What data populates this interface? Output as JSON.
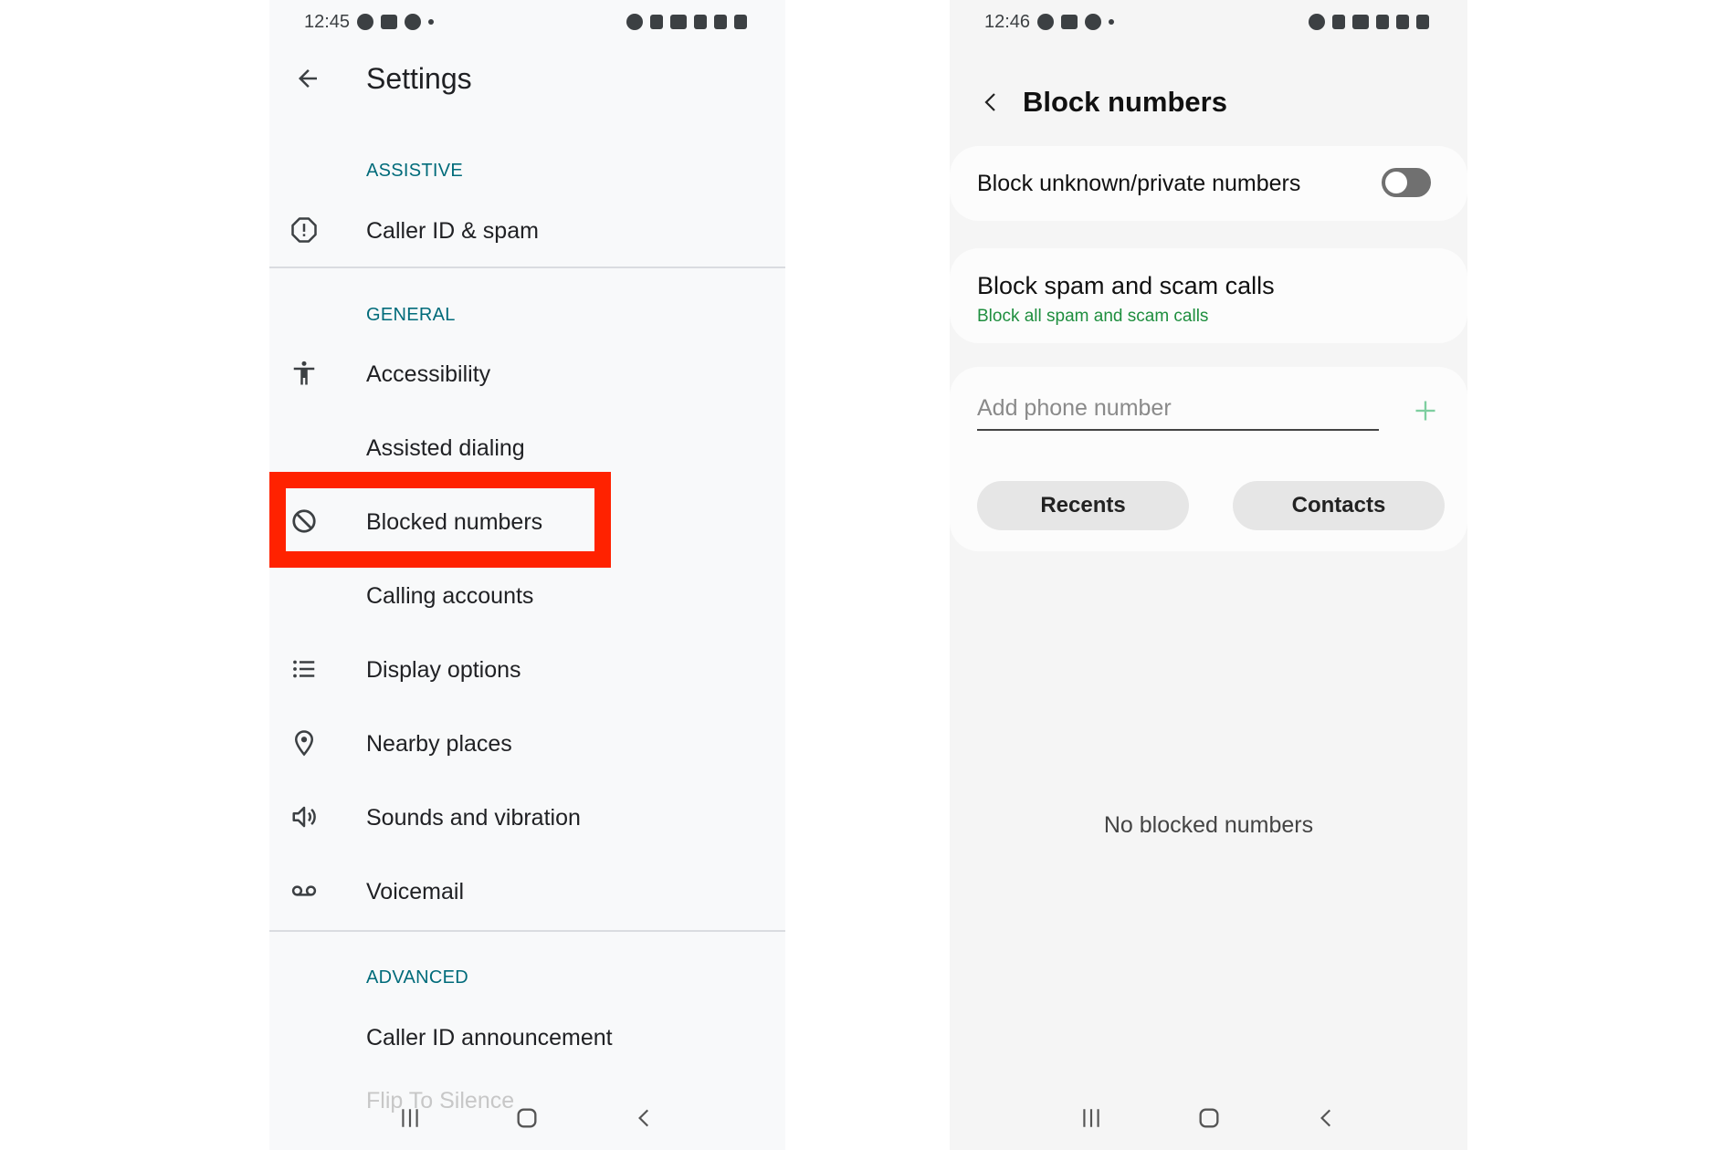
{
  "left": {
    "status_time": "12:45",
    "title": "Settings",
    "sections": {
      "assistive": "ASSISTIVE",
      "general": "GENERAL",
      "advanced": "ADVANCED"
    },
    "items": {
      "caller_id_spam": "Caller ID & spam",
      "accessibility": "Accessibility",
      "assisted_dialing": "Assisted dialing",
      "blocked_numbers": "Blocked numbers",
      "calling_accounts": "Calling accounts",
      "display_options": "Display options",
      "nearby_places": "Nearby places",
      "sounds_vibration": "Sounds and vibration",
      "voicemail": "Voicemail",
      "caller_id_announcement": "Caller ID announcement",
      "flip_to_silence": "Flip To Silence"
    },
    "icons": {
      "back": "arrow-left-icon",
      "caller_id": "alert-circle-icon",
      "accessibility": "accessibility-icon",
      "blocked": "block-icon",
      "display": "list-icon",
      "nearby": "location-pin-icon",
      "sounds": "speaker-icon",
      "voicemail": "voicemail-icon"
    },
    "highlight_color": "#ff2200"
  },
  "right": {
    "status_time": "12:46",
    "title": "Block numbers",
    "block_unknown_label": "Block unknown/private numbers",
    "block_unknown_enabled": false,
    "block_spam_title": "Block spam and scam calls",
    "block_spam_subtitle": "Block all spam and scam calls",
    "add_phone_placeholder": "Add phone number",
    "recents_label": "Recents",
    "contacts_label": "Contacts",
    "empty_message": "No blocked numbers",
    "accent_color": "#1e8e3e"
  }
}
